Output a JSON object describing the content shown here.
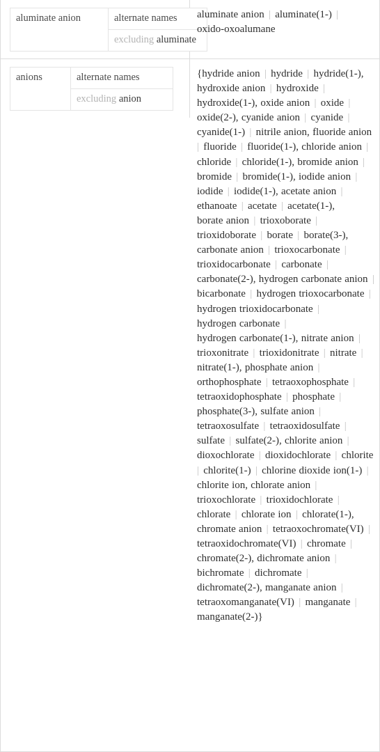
{
  "pods": [
    {
      "id": "aluminate-anion",
      "assumption": {
        "subject": "aluminate anion",
        "options": [
          {
            "kind": "selected",
            "label": "alternate names"
          },
          {
            "kind": "alternate",
            "dim": "excluding",
            "strong": "aluminate"
          }
        ]
      },
      "result": {
        "brace_open": "",
        "brace_close": "",
        "items": [
          "aluminate anion",
          "aluminate(1-)",
          "oxido-oxoalumane"
        ]
      }
    },
    {
      "id": "anions",
      "assumption": {
        "subject": "anions",
        "options": [
          {
            "kind": "selected",
            "label": "alternate names"
          },
          {
            "kind": "alternate",
            "dim": "excluding",
            "strong": "anion"
          }
        ]
      },
      "result": {
        "brace_open": "{",
        "brace_close": "}",
        "items": [
          "hydride anion",
          "hydride",
          "hydride(1-),",
          "hydroxide anion",
          "hydroxide",
          "hydroxide(1-),",
          "oxide anion",
          "oxide",
          "oxide(2-),",
          "cyanide anion",
          "cyanide",
          "cyanide(1-)",
          "nitrile anion,",
          "fluoride anion",
          "fluoride",
          "fluoride(1-),",
          "chloride anion",
          "chloride",
          "chloride(1-),",
          "bromide anion",
          "bromide",
          "bromide(1-),",
          "iodide anion",
          "iodide",
          "iodide(1-),",
          "acetate anion",
          "ethanoate",
          "acetate",
          "acetate(1-),",
          "borate anion",
          "trioxoborate",
          "trioxidoborate",
          "borate",
          "borate(3-),",
          "carbonate anion",
          "trioxocarbonate",
          "trioxidocarbonate",
          "carbonate",
          "carbonate(2-),",
          "hydrogen carbonate anion",
          "bicarbonate",
          "hydrogen trioxocarbonate",
          "hydrogen trioxidocarbonate",
          "hydrogen carbonate",
          "hydrogen carbonate(1-),",
          "nitrate anion",
          "trioxonitrate",
          "trioxidonitrate",
          "nitrate",
          "nitrate(1-),",
          "phosphate anion",
          "orthophosphate",
          "tetraoxophosphate",
          "tetraoxidophosphate",
          "phosphate",
          "phosphate(3-),",
          "sulfate anion",
          "tetraoxosulfate",
          "tetraoxidosulfate",
          "sulfate",
          "sulfate(2-),",
          "chlorite anion",
          "dioxochlorate",
          "dioxidochlorate",
          "chlorite",
          "chlorite(1-)",
          "chlorine dioxide ion(1-)",
          "chlorite ion,",
          "chlorate anion",
          "trioxochlorate",
          "trioxidochlorate",
          "chlorate",
          "chlorate ion",
          "chlorate(1-),",
          "chromate anion",
          "tetraoxochromate(VI)",
          "tetraoxidochromate(VI)",
          "chromate",
          "chromate(2-),",
          "dichromate anion",
          "bichromate",
          "dichromate",
          "dichromate(2-),",
          "manganate anion",
          "tetraoxomanganate(VI)",
          "manganate",
          "manganate(2-)"
        ]
      }
    }
  ],
  "separator_glyph": "|",
  "colors": {
    "border": "#dcdcdc",
    "cell_border": "#e4e4e4",
    "subject_bg": "#f5f5f5",
    "text": "#3c3c3c",
    "dim_text": "#b4b4b4",
    "separator": "#c0c0c0"
  }
}
